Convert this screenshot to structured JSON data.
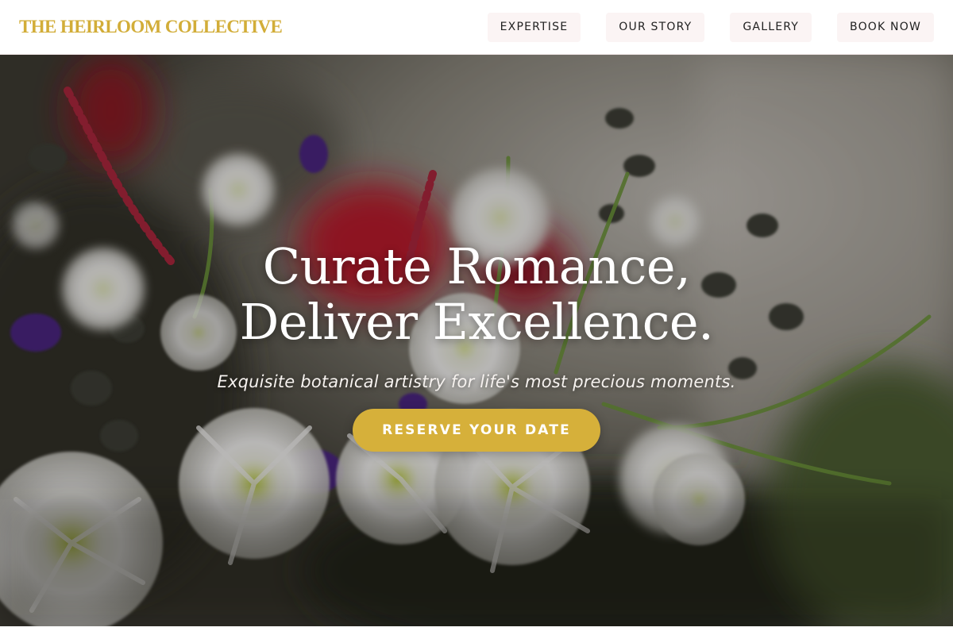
{
  "header": {
    "brand": "THE HEIRLOOM COLLECTIVE",
    "nav": [
      {
        "label": "EXPERTISE"
      },
      {
        "label": "OUR STORY"
      },
      {
        "label": "GALLERY"
      },
      {
        "label": "BOOK NOW"
      }
    ]
  },
  "hero": {
    "title_line1": "Curate Romance,",
    "title_line2": "Deliver Excellence.",
    "subtitle": "Exquisite botanical artistry for life's most precious moments.",
    "cta_label": "RESERVE YOUR DATE",
    "background_icon": "flower-bouquet-photo"
  },
  "colors": {
    "brand_gold": "#d2ad38",
    "cta_gold": "#d6b03a",
    "nav_pill": "#fbf4f4",
    "nav_text": "#1f1f1f"
  }
}
